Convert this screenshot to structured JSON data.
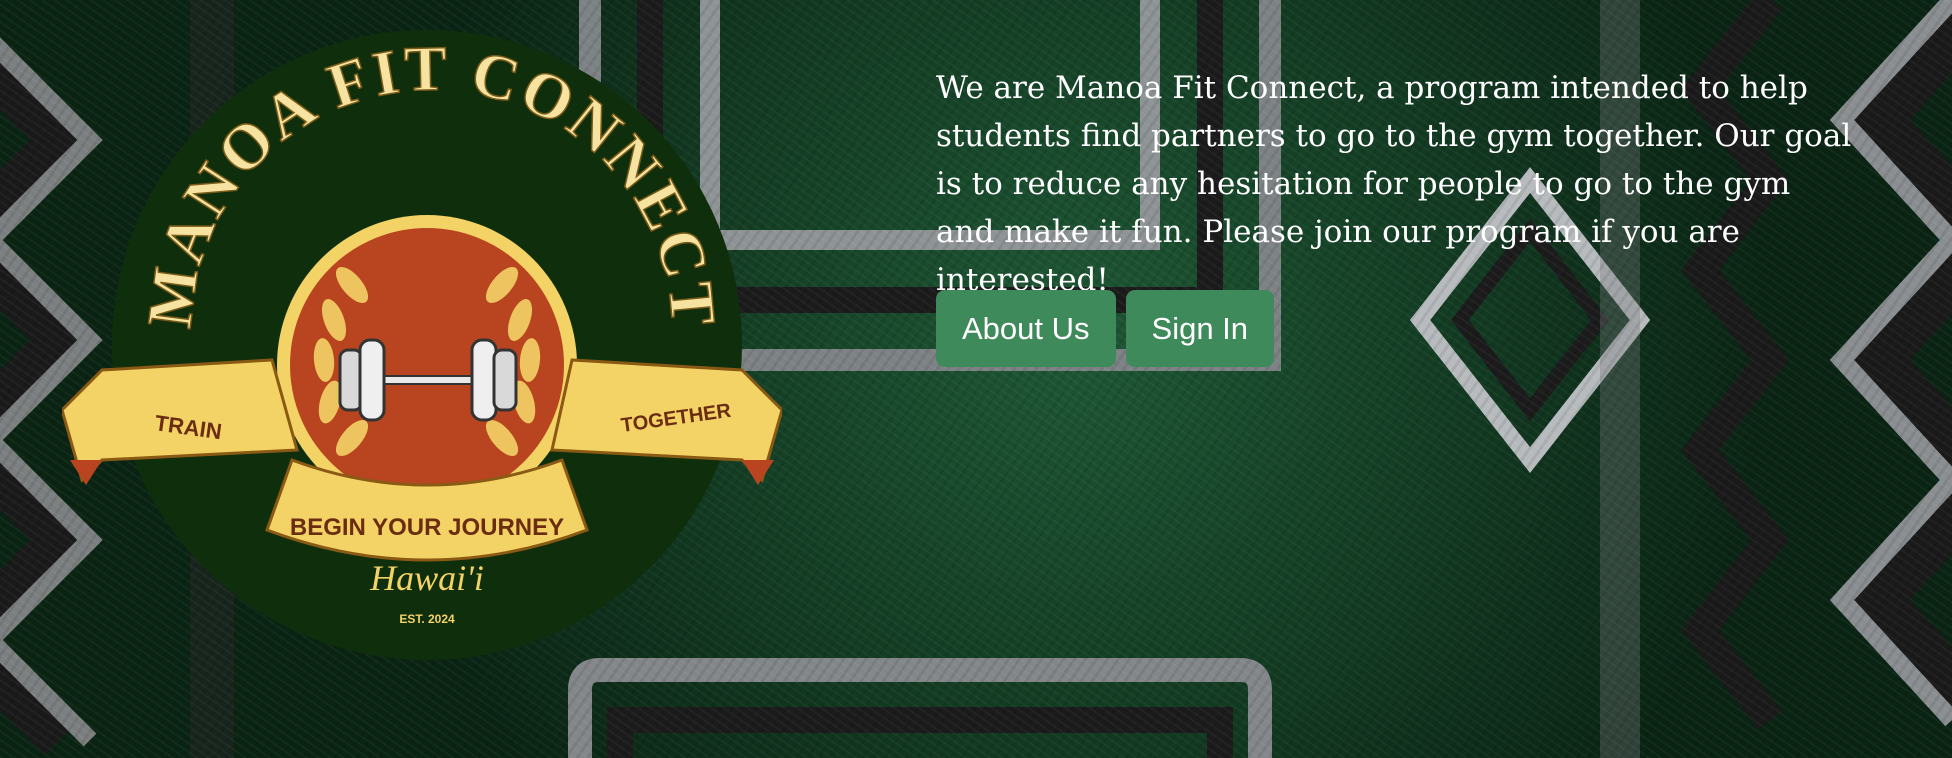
{
  "logo": {
    "title": "MANOA FIT CONNECT",
    "left_ribbon": "TRAIN",
    "right_ribbon": "TOGETHER",
    "bottom_ribbon": "BEGIN YOUR JOURNEY",
    "place": "Hawai'i",
    "established": "EST. 2024"
  },
  "intro": {
    "text": "We are Manoa Fit Connect, a program intended to help students find partners to go to the gym together. Our goal is to reduce any hesitation for people to go to the gym and make it fun. Please join our program if you are interested!"
  },
  "buttons": {
    "about_label": "About Us",
    "signin_label": "Sign In"
  },
  "colors": {
    "button_bg": "#3f8a5a",
    "logo_circle": "#0f2f0c",
    "logo_gold": "#f3d266",
    "logo_rust": "#b8451f"
  }
}
